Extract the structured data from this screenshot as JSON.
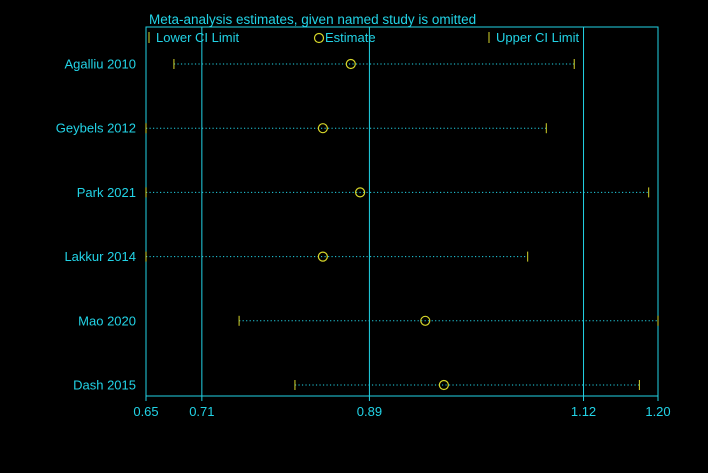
{
  "chart_data": {
    "type": "scatter",
    "title": "Meta-analysis estimates, given named study is omitted",
    "legend": {
      "placement": "top",
      "lower": "Lower CI Limit",
      "estimate": "Estimate",
      "upper": "Upper CI Limit"
    },
    "studies": [
      {
        "label": "Agalliu 2010",
        "lower": 0.68,
        "estimate": 0.87,
        "upper": 1.11
      },
      {
        "label": "Geybels 2012",
        "lower": 0.65,
        "estimate": 0.84,
        "upper": 1.08
      },
      {
        "label": "Park 2021",
        "lower": 0.65,
        "estimate": 0.88,
        "upper": 1.19
      },
      {
        "label": "Lakkur 2014",
        "lower": 0.65,
        "estimate": 0.84,
        "upper": 1.06
      },
      {
        "label": "Mao 2020",
        "lower": 0.75,
        "estimate": 0.95,
        "upper": 1.2
      },
      {
        "label": "Dash 2015",
        "lower": 0.81,
        "estimate": 0.97,
        "upper": 1.18
      }
    ],
    "x_ticks": [
      0.65,
      0.71,
      0.89,
      1.12,
      1.2
    ],
    "x_tick_labels": [
      "0.65",
      "0.71",
      "0.89",
      "1.12",
      "1.20"
    ],
    "reference_lines": [
      0.71,
      0.89,
      1.12
    ],
    "xlim": [
      0.65,
      1.2
    ],
    "colors": {
      "background": "#000000",
      "axis": "#22d3e6",
      "text": "#22d3e6",
      "marker": "#d6d62a"
    }
  }
}
